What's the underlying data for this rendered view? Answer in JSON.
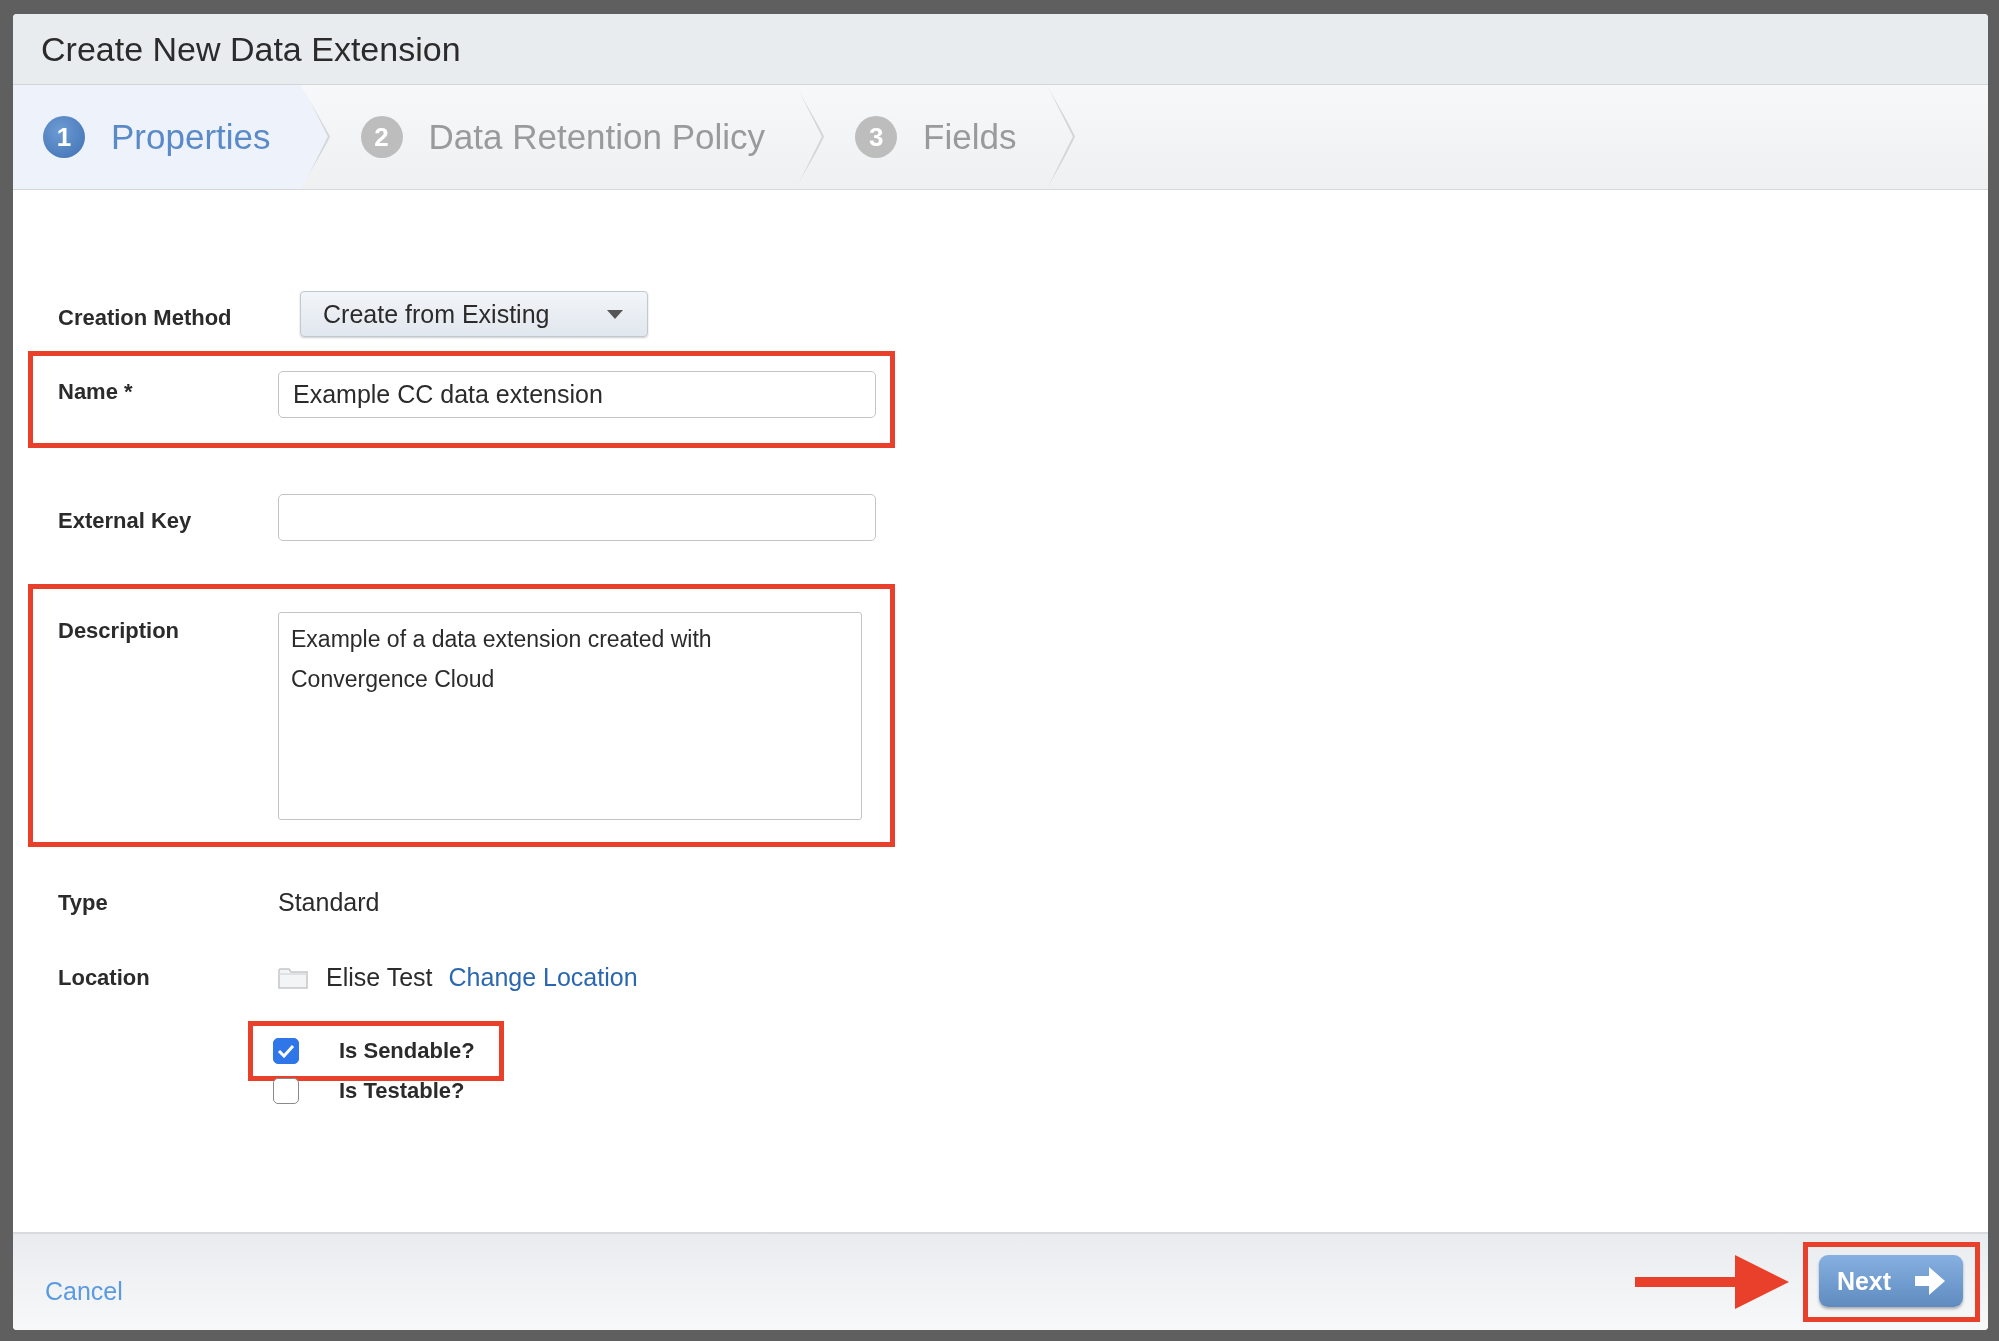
{
  "window": {
    "title": "Create New Data Extension"
  },
  "steps": [
    {
      "number": "1",
      "label": "Properties",
      "selected": true
    },
    {
      "number": "2",
      "label": "Data Retention Policy",
      "selected": false
    },
    {
      "number": "3",
      "label": "Fields",
      "selected": false
    }
  ],
  "form": {
    "creation_method": {
      "label": "Creation Method",
      "value": "Create from Existing"
    },
    "fields": [
      {
        "kind": "text",
        "label": "Name *",
        "value": "Example CC data extension",
        "highlighted": true
      },
      {
        "kind": "text",
        "label": "External Key",
        "highlighted": false
      },
      {
        "kind": "textarea",
        "label": "Description",
        "value": "Example of a data extension created with Convergence Cloud",
        "highlighted": true
      }
    ],
    "type": {
      "label": "Type",
      "value": "Standard"
    },
    "location": {
      "label": "Location",
      "folder": "Elise Test",
      "link": "Change Location"
    },
    "checkboxes": [
      {
        "label": "Is Sendable?",
        "checked": true,
        "highlighted": true
      },
      {
        "label": "Is Testable?",
        "checked": false,
        "highlighted": false
      }
    ]
  },
  "footer": {
    "cancel": "Cancel",
    "next": {
      "label": "Next",
      "highlighted": true,
      "arrow": true
    }
  }
}
